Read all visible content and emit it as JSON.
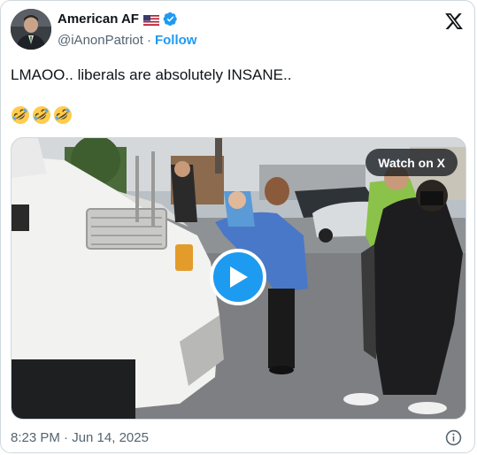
{
  "author": {
    "display_name": "American AF",
    "handle": "@iAnonPatriot",
    "follow_label": "Follow",
    "separator": "·"
  },
  "tweet": {
    "text": "LMAOO.. liberals are absolutely INSANE..",
    "emojis": [
      "rolling-on-floor-laughing",
      "rolling-on-floor-laughing",
      "rolling-on-floor-laughing"
    ]
  },
  "media": {
    "watch_label": "Watch on X"
  },
  "footer": {
    "timestamp": "8:23 PM · Jun 14, 2025"
  },
  "colors": {
    "accent": "#1d9bf0",
    "text": "#0f1419",
    "secondary": "#536471",
    "border": "#cfd9de"
  },
  "icons": [
    "flag-us-icon",
    "verified-badge-icon",
    "x-logo-icon",
    "play-icon",
    "info-icon"
  ]
}
